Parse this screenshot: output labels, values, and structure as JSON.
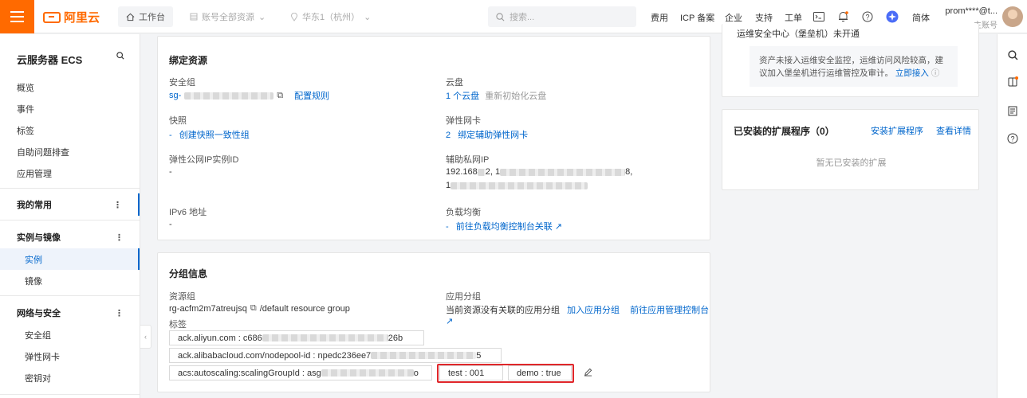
{
  "topbar": {
    "logo_text": "阿里云",
    "workbench": "工作台",
    "resource_scope": "账号全部资源",
    "region": "华东1（杭州）",
    "search_placeholder": "搜索...",
    "nav": [
      "费用",
      "ICP 备案",
      "企业",
      "支持",
      "工单"
    ],
    "lang": "简体",
    "user_name": "prom****@t...",
    "user_role": "主账号"
  },
  "sidebar": {
    "title": "云服务器 ECS",
    "items": [
      "概览",
      "事件",
      "标签",
      "自助问题排查",
      "应用管理"
    ],
    "favorites": "我的常用",
    "group1": {
      "label": "实例与镜像",
      "children": [
        "实例",
        "镜像"
      ]
    },
    "group2": {
      "label": "网络与安全",
      "children": [
        "安全组",
        "弹性网卡",
        "密钥对"
      ]
    }
  },
  "binding": {
    "title": "绑定资源",
    "security_group_label": "安全组",
    "security_group_value": "sg-",
    "config_rules": "配置规则",
    "disk_label": "云盘",
    "disk_count": "1 个云盘",
    "disk_reinit": "重新初始化云盘",
    "snapshot_label": "快照",
    "snapshot_dash": "-",
    "snapshot_link": "创建快照一致性组",
    "eni_label": "弹性网卡",
    "eni_count": "2",
    "eni_link": "绑定辅助弹性网卡",
    "eip_label": "弹性公网IP实例ID",
    "eip_value": "-",
    "secondary_ip_label": "辅助私网IP",
    "secondary_ip_line1_start": "192.168",
    "secondary_ip_line1_mid": "2, 1",
    "secondary_ip_line1_end": "8,",
    "secondary_ip_line2_start": "1",
    "ipv6_label": "IPv6 地址",
    "ipv6_value": "-",
    "lb_label": "负载均衡",
    "lb_dash": "-",
    "lb_link": "前往负载均衡控制台关联"
  },
  "group_info": {
    "title": "分组信息",
    "rg_label": "资源组",
    "rg_value": "rg-acfm2m7atreujsq",
    "rg_name": "/default resource group",
    "app_group_label": "应用分组",
    "app_group_text": "当前资源没有关联的应用分组",
    "add_app_group": "加入应用分组",
    "goto_app_console": "前往应用管理控制台",
    "tags_label": "标签",
    "tags": {
      "t1_prefix": "ack.aliyun.com : c686",
      "t1_suffix": "26b",
      "t2_prefix": "ack.alibabacloud.com/nodepool-id : npedc236ee7",
      "t2_suffix": "5",
      "t3_prefix": "acs:autoscaling:scalingGroupId : asg",
      "t3_suffix": "o",
      "t4": "test : 001",
      "t5": "demo : true"
    }
  },
  "right_panel": {
    "notice_header": "运维安全中心（堡垒机）未开通",
    "notice_text": "资产未接入运维安全监控，运维访问风险较高，建议加入堡垒机进行运维管控及审计。",
    "notice_link": "立即接入",
    "ext_title": "已安装的扩展程序（0）",
    "install_ext": "安装扩展程序",
    "view_detail": "查看详情",
    "empty_text": "暂无已安装的扩展"
  },
  "colors": {
    "brand": "#ff6a00",
    "link": "#0066cc",
    "highlight": "#e0262a"
  }
}
